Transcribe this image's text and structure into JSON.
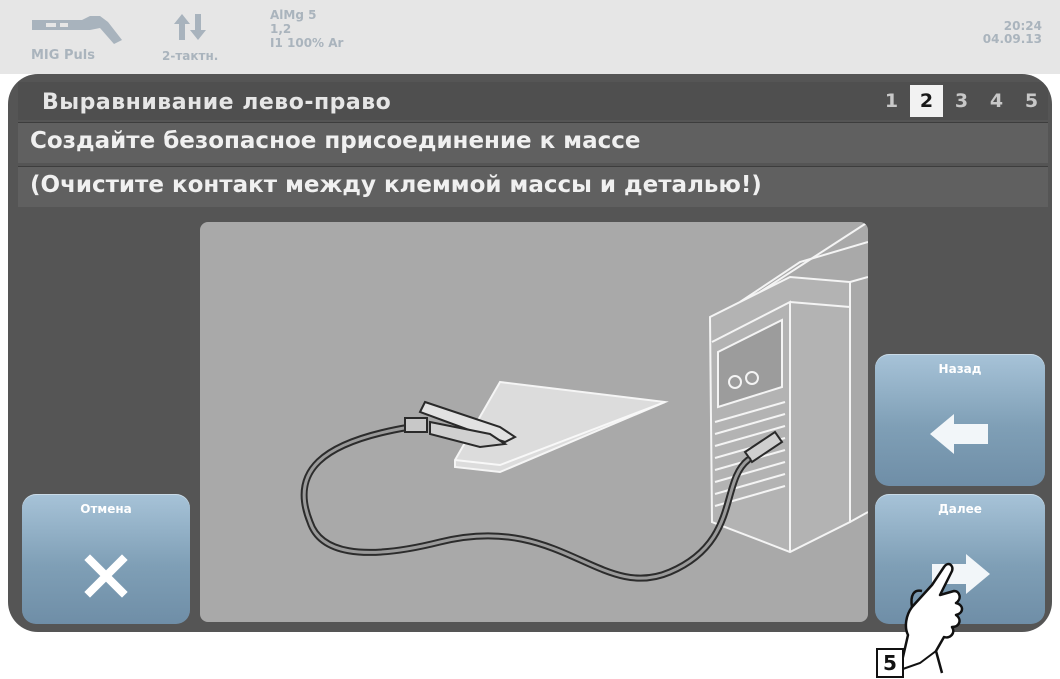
{
  "status": {
    "mode_label": "MIG Puls",
    "trigger_label": "2-тактн.",
    "material_line1": "AlMg 5",
    "material_line2": "1,2",
    "material_line3": "I1 100% Ar",
    "time": "20:24",
    "date": "04.09.13"
  },
  "wizard": {
    "title": "Выравнивание  лево-право",
    "steps": [
      "1",
      "2",
      "3",
      "4",
      "5"
    ],
    "active_step": "2",
    "instruction1": "Создайте безопасное присоединение к массе",
    "instruction2": "(Очистите контакт между клеммой массы и деталью!)"
  },
  "buttons": {
    "cancel_label": "Отмена",
    "back_label": "Назад",
    "next_label": "Далее"
  },
  "callout": {
    "number": "5"
  },
  "colors": {
    "panel": "#555555",
    "button": "#8eaec4",
    "status_text": "#aab4bd"
  },
  "icons": {
    "mode": "welding-torch-icon",
    "trigger": "up-down-arrows-icon",
    "cancel": "close-icon",
    "back": "arrow-left-icon",
    "next": "arrow-right-icon"
  }
}
